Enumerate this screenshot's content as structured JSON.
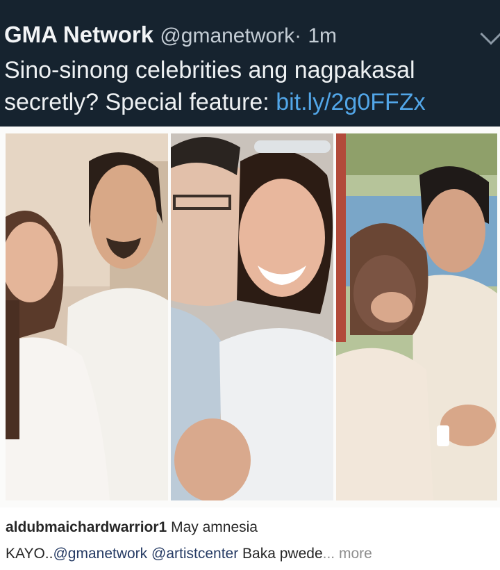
{
  "tweet": {
    "author": "GMA Network",
    "handle": "@gmanetwork",
    "separator": "·",
    "time": "1m",
    "text": "Sino-sinong celebrities ang nagpakasal secretly? Special feature: ",
    "link": "bit.ly/2g0FFZx",
    "line1": "Sino-sinong celebrities ang nagpakasal",
    "line2": "secretly? Special feature: "
  },
  "caption": {
    "username": "aldubmaichardwarrior1",
    "text1": " May amnesia",
    "text2": "KAYO..",
    "mention1": "@gmanetwork",
    "mention2": "@artistcenter",
    "text3": " Baka pwede",
    "more": "... more"
  },
  "colors": {
    "tweet_bg": "#16232f",
    "link": "#52a6e8",
    "mention": "#263b64"
  }
}
